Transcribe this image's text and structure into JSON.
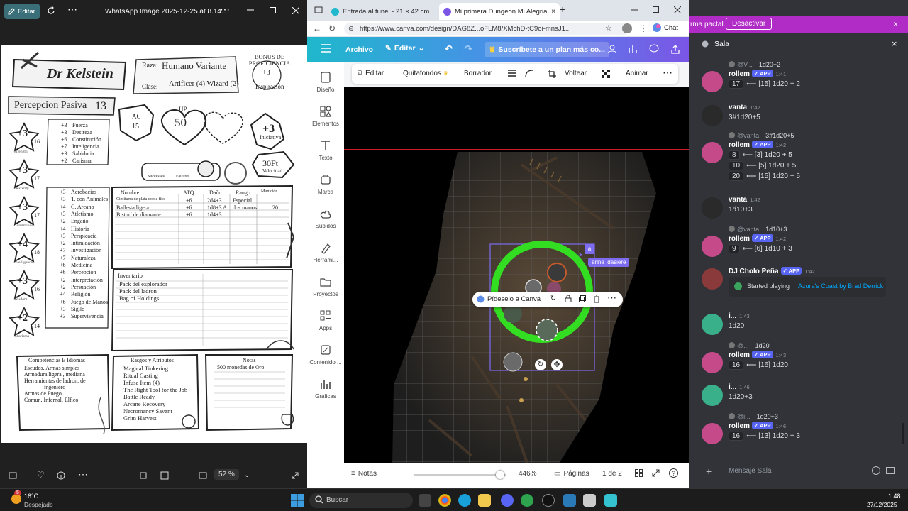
{
  "viewer": {
    "edit_label": "Editar",
    "title": "WhatsApp Image 2025-12-25 at 8.14....",
    "zoom": "52 %",
    "sheet": {
      "name": "Dr Kelstein",
      "race_label": "Raza:",
      "race": "Humano Variante",
      "class_label": "Clase:",
      "class": "Artificer (4) Wizard (2)",
      "prof_bonus_label": "BONUS DE PROFICIENCIA",
      "prof_bonus": "+3",
      "inspiration": "Inspiración",
      "passive_label": "Percepcion Pasiva",
      "passive_value": "13",
      "ac_label": "AC",
      "ac": "15",
      "hp_label": "HP",
      "hp": "50",
      "initiative": "+3",
      "initiative_label": "Iniciativa",
      "speed": "30Ft",
      "speed_label": "Velocidad",
      "successes": "Successes",
      "failures": "Failures",
      "abilities": [
        {
          "mod": "+3",
          "score": "16",
          "name": "Strength"
        },
        {
          "mod": "+3",
          "score": "17",
          "name": "Dexterity"
        },
        {
          "mod": "+3",
          "score": "17",
          "name": "Constitution"
        },
        {
          "mod": "+4",
          "score": "18",
          "name": "Intelligence"
        },
        {
          "mod": "+3",
          "score": "16",
          "name": "Wisdom"
        },
        {
          "mod": "+2",
          "score": "14",
          "name": "Charisma"
        }
      ],
      "saves": [
        {
          "v": "+3",
          "n": "Fuerza"
        },
        {
          "v": "+3",
          "n": "Destreza"
        },
        {
          "v": "+6",
          "n": "Constitución"
        },
        {
          "v": "+7",
          "n": "Inteligencia"
        },
        {
          "v": "+3",
          "n": "Sabiduria"
        },
        {
          "v": "+2",
          "n": "Carisma"
        }
      ],
      "skills": [
        {
          "v": "+3",
          "n": "Acrobacias"
        },
        {
          "v": "+3",
          "n": "T. con Animales"
        },
        {
          "v": "+4",
          "n": "C. Arcano"
        },
        {
          "v": "+3",
          "n": "Atletismo"
        },
        {
          "v": "+2",
          "n": "Engaño"
        },
        {
          "v": "+4",
          "n": "Historia"
        },
        {
          "v": "+3",
          "n": "Perspicacia"
        },
        {
          "v": "+2",
          "n": "Intimidación"
        },
        {
          "v": "+7",
          "n": "Investigación"
        },
        {
          "v": "+7",
          "n": "Naturaleza"
        },
        {
          "v": "+6",
          "n": "Medicina"
        },
        {
          "v": "+6",
          "n": "Percepción"
        },
        {
          "v": "+2",
          "n": "Interpretación"
        },
        {
          "v": "+2",
          "n": "Persuación"
        },
        {
          "v": "+4",
          "n": "Religión"
        },
        {
          "v": "+6",
          "n": "Juego de Manos"
        },
        {
          "v": "+3",
          "n": "Sigilo"
        },
        {
          "v": "+3",
          "n": "Supervivencia"
        }
      ],
      "attack_headers": [
        "Nombre:",
        "ATQ",
        "Daño",
        "Rango",
        "Munición"
      ],
      "attacks": [
        {
          "name": "Cimitarra de plata doble filo",
          "atq": "+6",
          "dmg": "2d4+3",
          "range": "Especial",
          "ammo": ""
        },
        {
          "name": "Ballesta ligera",
          "atq": "+6",
          "dmg": "1d8+3 A",
          "range": "dos manos",
          "ammo": "20"
        },
        {
          "name": "Bisturí de diamante",
          "atq": "+6",
          "dmg": "1d4+3",
          "range": "",
          "ammo": ""
        }
      ],
      "inventory_label": "Inventario",
      "inventory": [
        "Pack del explorador",
        "Pack del ladron",
        "Bag of Holdings"
      ],
      "prof_title": "Competencias E Idiomas",
      "prof_lines": [
        "Escudos, Armas simples",
        "Armadura ligera , mediana",
        "Herramientas de ladron, de",
        "ingeniero",
        "Armas de Fuego",
        "Comun, Infernal, Elfico"
      ],
      "traits_title": "Rasgos y Atributos",
      "traits": [
        "Magical Tinkering",
        "Ritual Casting",
        "Infuse Item (4)",
        "The Right Tool for the Job",
        "Battle Ready",
        "Arcane Recovery",
        "Necromancy Savant",
        "Grim Harvest"
      ],
      "notes_title": "Notas",
      "notes": [
        "500 monedas de Oro"
      ]
    }
  },
  "browser": {
    "tabs": [
      {
        "label": "Entrada al tunel - 21 × 42 cm"
      },
      {
        "label": "Mi primera Dungeon Mi Alegria -"
      }
    ],
    "url": "https://www.canva.com/design/DAG8Z...oFLM8/XMchD-tC9oi-mnsJ1...",
    "chat_label": "Chat",
    "canva": {
      "top": {
        "archivo": "Archivo",
        "editar": "Editar",
        "promo": "Suscríbete a un plan más co..."
      },
      "rail": [
        "Diseño",
        "Elementos",
        "Texto",
        "Marca",
        "Subidos",
        "Herrami...",
        "Proyectos",
        "Apps",
        "Contenido ...",
        "Gráficas"
      ],
      "toolbar": [
        "Editar",
        "Quitafondos",
        "Borrador",
        "Voltear",
        "Animar"
      ],
      "ask_label": "Pídeselo a Canva",
      "user_tag": "arlne_dasiere",
      "user_initial": "a",
      "bottom": {
        "notas": "Notas",
        "zoom": "446%",
        "paginas": "Páginas",
        "page": "1 de 2"
      }
    }
  },
  "discord": {
    "banner_text": "rma pactal.",
    "banner_button": "Desactivar",
    "channel": "Sala",
    "input_placeholder": "Mensaje Sala",
    "messages": [
      {
        "type": "reply",
        "reply_name": "@V...",
        "reply_text": "1d20+2",
        "name": "rollem",
        "app": true,
        "time": "1:41",
        "result": "17",
        "text": "⟵ [15] 1d20 + 2"
      },
      {
        "type": "plain",
        "name": "vanta",
        "time": "1:42",
        "text": "3#1d20+5"
      },
      {
        "type": "reply3",
        "reply_name": "@vanta",
        "reply_text": "3#1d20+5",
        "name": "rollem",
        "app": true,
        "time": "1:42",
        "rows": [
          {
            "r": "8",
            "t": "⟵ [3] 1d20 + 5"
          },
          {
            "r": "10",
            "t": "⟵ [5] 1d20 + 5"
          },
          {
            "r": "20",
            "t": "⟵ [15] 1d20 + 5"
          }
        ]
      },
      {
        "type": "plain",
        "name": "vanta",
        "time": "1:42",
        "text": "1d10+3"
      },
      {
        "type": "reply",
        "reply_name": "@vanta",
        "reply_text": "1d10+3",
        "name": "rollem",
        "app": true,
        "time": "1:42",
        "result": "9",
        "text": "⟵ [6] 1d10 + 3"
      },
      {
        "type": "bot",
        "name": "DJ Cholo Peña",
        "app": true,
        "time": "1:42",
        "text_prefix": "Started playing",
        "link": "Azura's Coast by Brad Derrick"
      },
      {
        "type": "plain",
        "name": "i...",
        "time": "1:43",
        "text": "1d20"
      },
      {
        "type": "reply",
        "reply_name": "@...",
        "reply_text": "1d20",
        "name": "rollem",
        "app": true,
        "time": "1:43",
        "result": "16",
        "text": "⟵ [16] 1d20"
      },
      {
        "type": "plain",
        "name": "i...",
        "time": "1:46",
        "text": "1d20+3"
      },
      {
        "type": "reply",
        "reply_name": "@i...",
        "reply_text": "1d20+3",
        "name": "rollem",
        "app": true,
        "time": "1:46",
        "result": "16",
        "text": "⟵ [13] 1d20 + 3"
      }
    ]
  },
  "taskbar": {
    "weather_temp": "16°C",
    "weather_desc": "Despejado",
    "search": "Buscar",
    "time": "1:48",
    "date": "27/12/2025",
    "notif_count": "5"
  },
  "colors": {
    "canva_ring": "#33dd22",
    "discord_bg": "#313338",
    "app_badge": "#5865f2",
    "banner": "#b12bc6"
  }
}
